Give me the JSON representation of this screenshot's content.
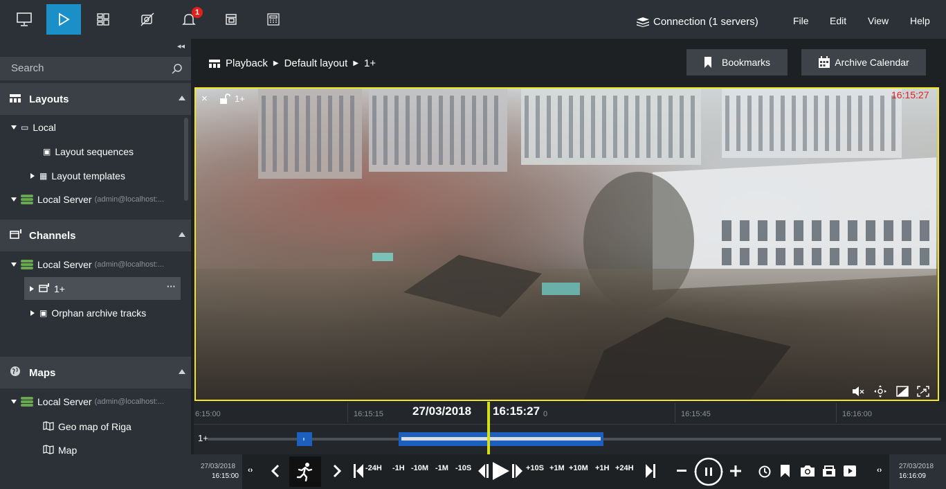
{
  "topbar": {
    "icons": [
      "monitor-icon",
      "play-icon",
      "layout-grid-icon",
      "no-camera-icon",
      "bell-icon",
      "windows-icon",
      "keypad-icon"
    ],
    "notification_count": "1",
    "connection_label": "Connection (1 servers)",
    "menu": {
      "file": "File",
      "edit": "Edit",
      "view": "View",
      "help": "Help"
    }
  },
  "sidebar": {
    "search_placeholder": "Search",
    "layouts": {
      "title": "Layouts",
      "local": "Local",
      "layout_sequences": "Layout sequences",
      "layout_templates": "Layout templates",
      "server": "Local Server",
      "server_user": "(admin@localhost:..."
    },
    "channels": {
      "title": "Channels",
      "server": "Local Server",
      "server_user": "(admin@localhost:...",
      "channel": "1+",
      "more": "···",
      "orphan": "Orphan archive tracks"
    },
    "maps": {
      "title": "Maps",
      "server": "Local Server",
      "server_user": "(admin@localhost:...",
      "geo": "Geo map of Riga",
      "map": "Map"
    }
  },
  "main": {
    "breadcrumb": {
      "part1": "Playback",
      "part2": "Default layout",
      "part3": "1+"
    },
    "bookmarks_label": "Bookmarks",
    "archive_calendar_label": "Archive Calendar"
  },
  "video": {
    "channel_label": "1+",
    "timestamp": "16:15:27",
    "close": "×"
  },
  "timeline": {
    "ticks": [
      "6:15:00",
      "16:15:15",
      "16:15:45",
      "16:16:00"
    ],
    "partial_tick": "0",
    "current_date": "27/03/2018",
    "current_time": "16:15:27",
    "track_label": "1+"
  },
  "controls": {
    "start_date": "27/03/2018",
    "start_time": "16:15:00",
    "end_date": "27/03/2018",
    "end_time": "16:16:09",
    "steps_back": [
      "-24H",
      "-1H",
      "-10M",
      "-1M",
      "-10S"
    ],
    "steps_fwd": [
      "+10S",
      "+1M",
      "+10M",
      "+1H",
      "+24H"
    ]
  },
  "colors": {
    "accent": "#1b8fc7",
    "selection_border": "#f1e920",
    "cursor": "#d6e017",
    "archive_blue": "#1c5fbf",
    "server_green": "#6aa84f",
    "badge_red": "#e0201a"
  }
}
